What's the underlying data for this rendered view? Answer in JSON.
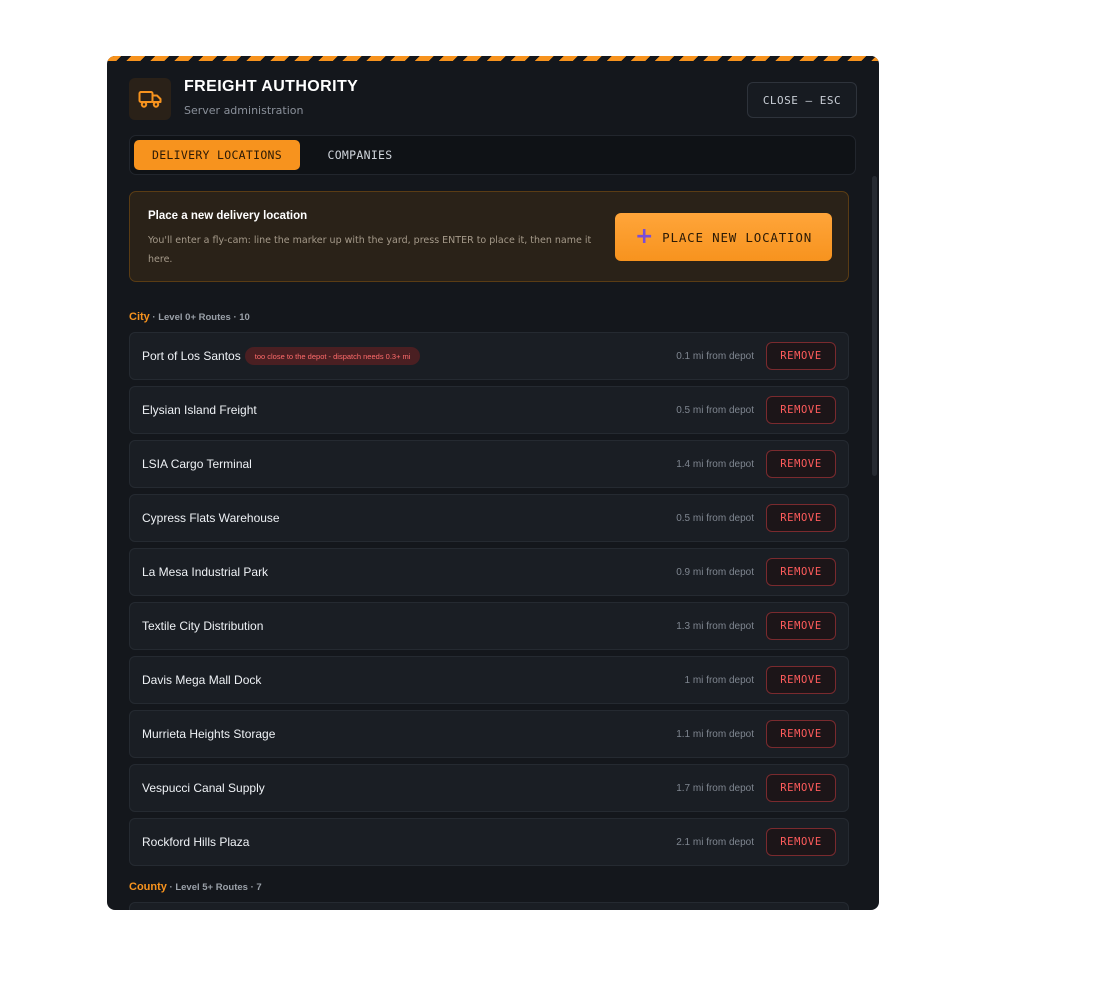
{
  "app": {
    "title": "FREIGHT AUTHORITY",
    "subtitle": "Server administration",
    "close_label": "CLOSE — ESC",
    "logo_icon": "truck-icon",
    "accent_color": "#f7931e",
    "danger_color": "#ff5c5c"
  },
  "tabs": [
    {
      "label": "DELIVERY LOCATIONS",
      "active": true
    },
    {
      "label": "COMPANIES",
      "active": false
    }
  ],
  "callout": {
    "title": "Place a new delivery location",
    "description": "You'll enter a fly-cam: line the marker up with the yard, press ENTER to place it, then name it here.",
    "button_label": "PLACE NEW LOCATION",
    "button_icon": "plus-icon"
  },
  "sections": [
    {
      "name": "City",
      "meta": " · Level 0+ Routes · 10",
      "rows": [
        {
          "name": "Port of Los Santos",
          "warning": "too close to the depot - dispatch needs 0.3+ mi",
          "distance": "0.1 mi from depot",
          "action": "REMOVE"
        },
        {
          "name": "Elysian Island Freight",
          "distance": "0.5 mi from depot",
          "action": "REMOVE"
        },
        {
          "name": "LSIA Cargo Terminal",
          "distance": "1.4 mi from depot",
          "action": "REMOVE"
        },
        {
          "name": "Cypress Flats Warehouse",
          "distance": "0.5 mi from depot",
          "action": "REMOVE"
        },
        {
          "name": "La Mesa Industrial Park",
          "distance": "0.9 mi from depot",
          "action": "REMOVE"
        },
        {
          "name": "Textile City Distribution",
          "distance": "1.3 mi from depot",
          "action": "REMOVE"
        },
        {
          "name": "Davis Mega Mall Dock",
          "distance": "1 mi from depot",
          "action": "REMOVE"
        },
        {
          "name": "Murrieta Heights Storage",
          "distance": "1.1 mi from depot",
          "action": "REMOVE"
        },
        {
          "name": "Vespucci Canal Supply",
          "distance": "1.7 mi from depot",
          "action": "REMOVE"
        },
        {
          "name": "Rockford Hills Plaza",
          "distance": "2.1 mi from depot",
          "action": "REMOVE"
        }
      ]
    },
    {
      "name": "County",
      "meta": " · Level 5+ Routes · 7",
      "rows": []
    }
  ]
}
